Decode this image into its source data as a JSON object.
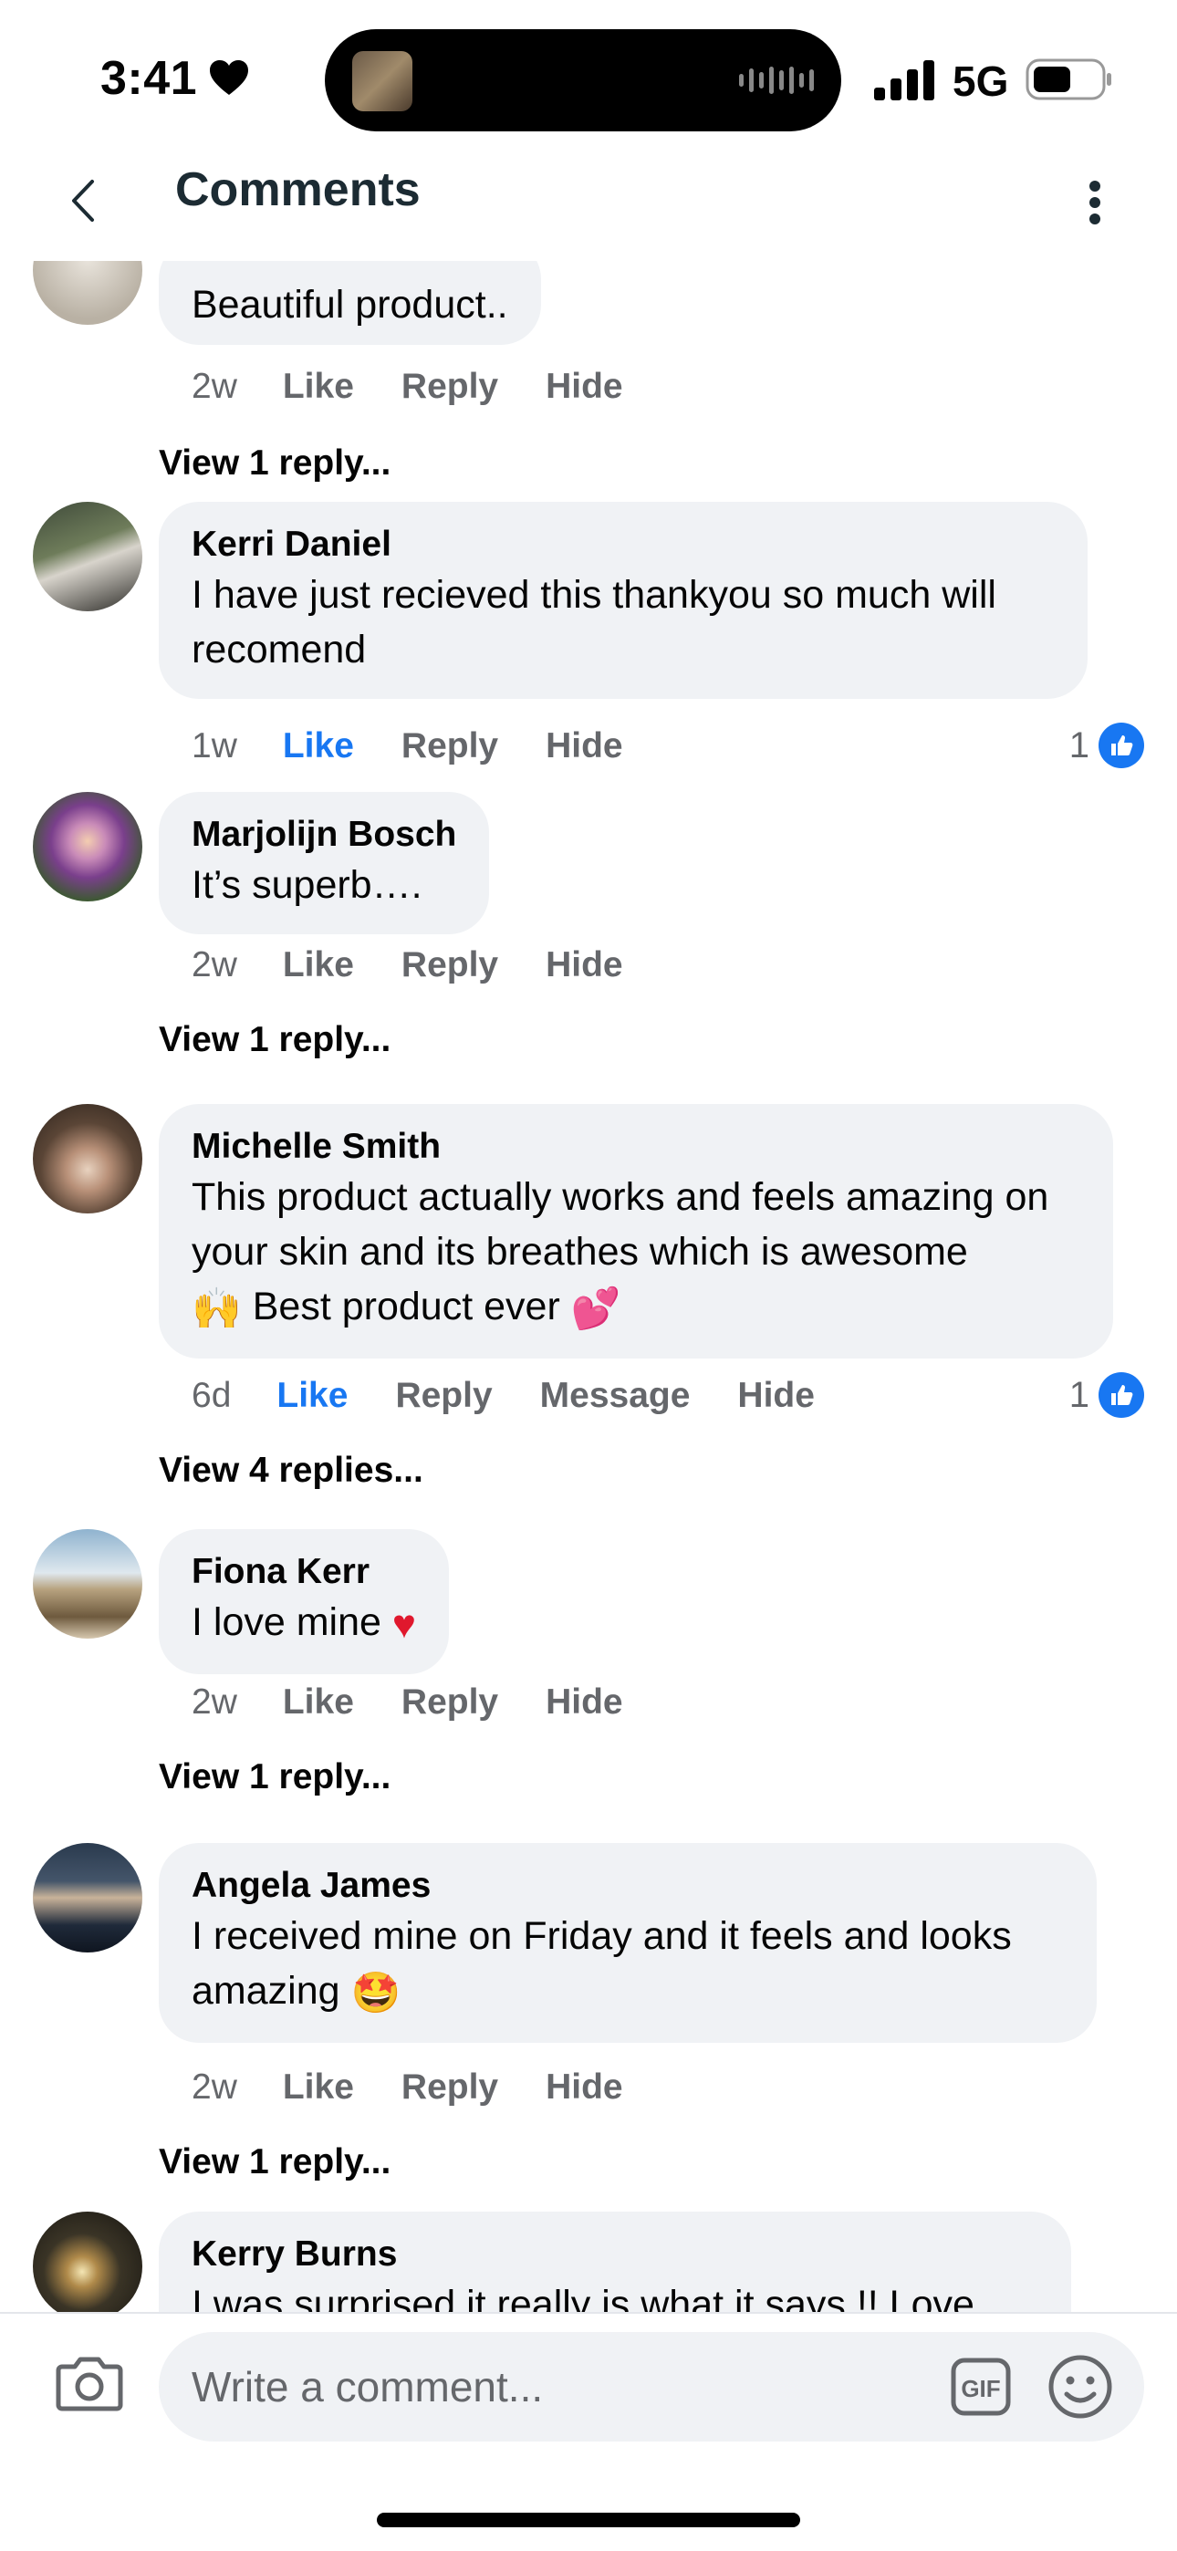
{
  "status_bar": {
    "time": "3:41",
    "network": "5G",
    "icons": [
      "heart-icon",
      "signal-icon",
      "battery-icon"
    ]
  },
  "header": {
    "title": "Comments",
    "icons": [
      "chevron-left-icon",
      "more-vertical-icon"
    ]
  },
  "comments": [
    {
      "author": "",
      "text": "Beautiful product..",
      "time": "2w",
      "actions": [
        "Like",
        "Reply",
        "Hide"
      ],
      "liked": false,
      "reactions": "",
      "view_replies": "View 1 reply..."
    },
    {
      "author": "Kerri Daniel",
      "text": "I have just recieved this thankyou so much will recomend",
      "time": "1w",
      "actions": [
        "Like",
        "Reply",
        "Hide"
      ],
      "liked": true,
      "reactions": "1",
      "view_replies": ""
    },
    {
      "author": "Marjolijn Bosch",
      "text": "It’s superb….",
      "time": "2w",
      "actions": [
        "Like",
        "Reply",
        "Hide"
      ],
      "liked": false,
      "reactions": "",
      "view_replies": "View 1 reply..."
    },
    {
      "author": "Michelle Smith",
      "text": "This product actually works and feels amazing on your skin and its breathes which is awesome",
      "text_after_emoji": "Best product ever",
      "time": "6d",
      "actions": [
        "Like",
        "Reply",
        "Message",
        "Hide"
      ],
      "liked": true,
      "reactions": "1",
      "view_replies": "View 4 replies..."
    },
    {
      "author": "Fiona Kerr",
      "text": "I love mine",
      "time": "2w",
      "actions": [
        "Like",
        "Reply",
        "Hide"
      ],
      "liked": false,
      "reactions": "",
      "view_replies": "View 1 reply..."
    },
    {
      "author": "Angela James",
      "text": "I received mine on Friday and it feels and looks amazing",
      "time": "2w",
      "actions": [
        "Like",
        "Reply",
        "Hide"
      ],
      "liked": false,
      "reactions": "",
      "view_replies": "View 1 reply..."
    },
    {
      "author": "Kerry Burns",
      "text": "I was surprised it really is what it says !!  Love",
      "time": "",
      "actions": [],
      "liked": false,
      "reactions": "",
      "view_replies": ""
    }
  ],
  "composer": {
    "placeholder": "Write a comment...",
    "icons": [
      "camera-icon",
      "gif-icon",
      "emoji-icon"
    ]
  },
  "colors": {
    "accent": "#1877f2",
    "bubble": "#f0f2f5",
    "secondary_text": "#65676b"
  }
}
